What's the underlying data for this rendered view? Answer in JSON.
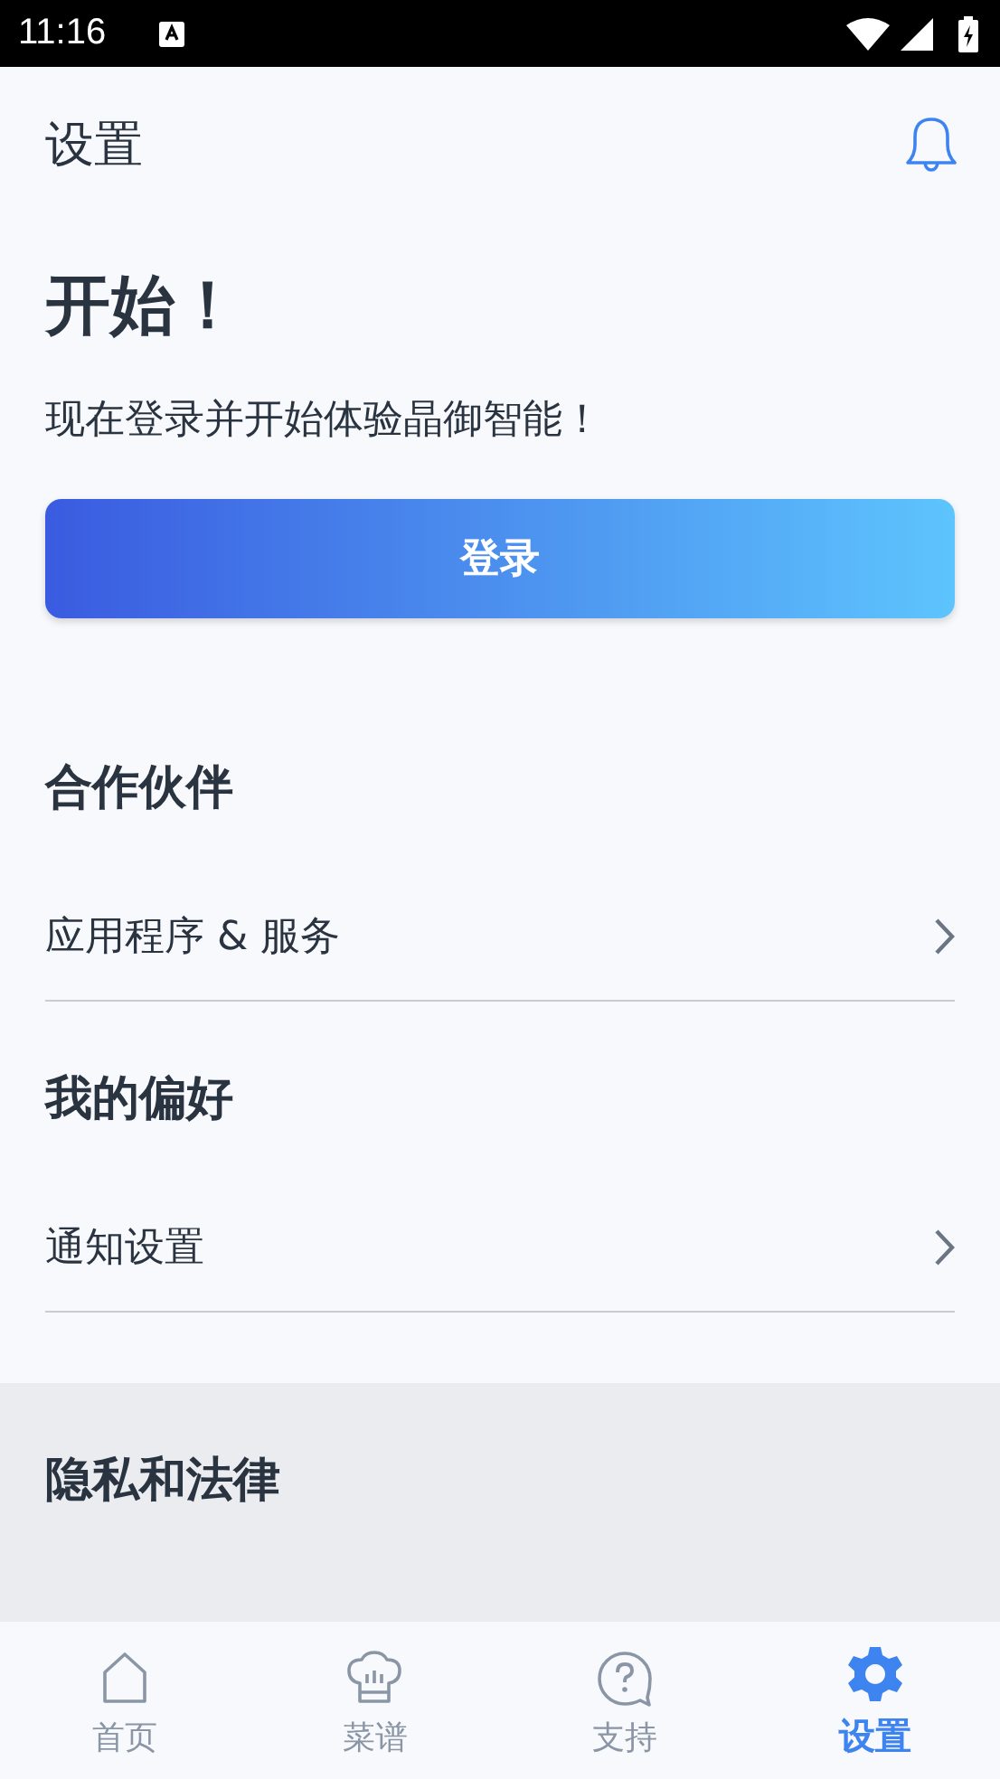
{
  "status_bar": {
    "time": "11:16"
  },
  "header": {
    "title": "设置"
  },
  "intro": {
    "heading": "开始！",
    "text": "现在登录并开始体验晶御智能！",
    "button": "登录"
  },
  "sections": [
    {
      "title": "合作伙伴",
      "shaded": false,
      "items": [
        "应用程序 & 服务"
      ]
    },
    {
      "title": "我的偏好",
      "shaded": false,
      "items": [
        "通知设置"
      ]
    },
    {
      "title": "隐私和法律",
      "shaded": true
    }
  ],
  "nav": [
    {
      "label": "首页",
      "kind": "home",
      "selected": false
    },
    {
      "label": "菜谱",
      "kind": "chef",
      "selected": false
    },
    {
      "label": "支持",
      "kind": "help",
      "selected": false
    },
    {
      "label": "设置",
      "kind": "gear",
      "selected": true
    }
  ]
}
